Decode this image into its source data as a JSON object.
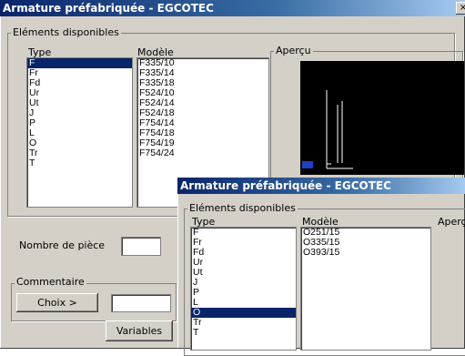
{
  "back": {
    "title": "Armature préfabriquée - EGCOTEC",
    "group_label": "Eléments disponibles",
    "type_header": "Type",
    "model_header": "Modèle",
    "preview_label": "Aperçu",
    "types": [
      "F",
      "Fr",
      "Fd",
      "Ur",
      "Ut",
      "J",
      "P",
      "L",
      "O",
      "Tr",
      "T"
    ],
    "selected_type_index": 0,
    "models": [
      "F335/10",
      "F335/14",
      "F335/18",
      "F524/10",
      "F524/14",
      "F524/18",
      "F754/14",
      "F754/18",
      "F754/19",
      "F754/24"
    ],
    "pieces_label": "Nombre de pièce",
    "comment_label": "Commentaire",
    "choix_label": "Choix >",
    "variables_label": "Variables"
  },
  "front": {
    "title": "Armature préfabriquée - EGCOTEC",
    "group_label": "Eléments disponibles",
    "type_header": "Type",
    "model_header": "Modèle",
    "preview_label": "Aperç",
    "types": [
      "F",
      "Fr",
      "Fd",
      "Ur",
      "Ut",
      "J",
      "P",
      "L",
      "O",
      "Tr",
      "T"
    ],
    "selected_type_index": 8,
    "models": [
      "O251/15",
      "O335/15",
      "O393/15"
    ]
  },
  "colors": {
    "selection": "#0a246a",
    "face": "#d4d0c8",
    "preview_bg": "#000000"
  }
}
